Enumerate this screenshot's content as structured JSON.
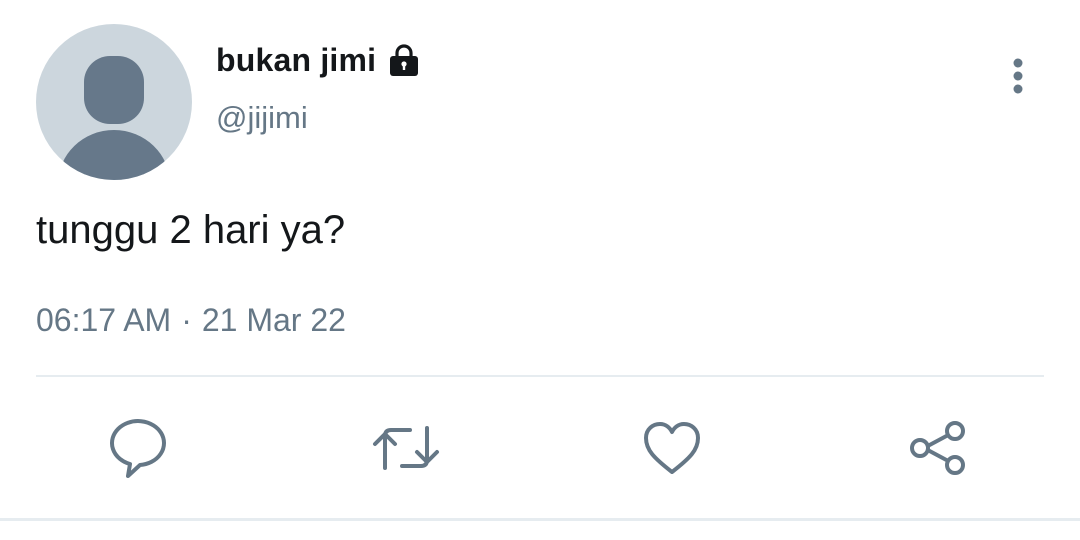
{
  "tweet": {
    "author": {
      "display_name": "bukan jimi",
      "handle": "@jijimi",
      "protected_icon": "lock-icon",
      "avatar_icon": "default-avatar"
    },
    "text": "tunggu 2 hari ya?",
    "time": "06:17 AM",
    "separator": "·",
    "date": "21 Mar 22"
  },
  "actions": [
    {
      "name": "reply",
      "icon": "comment-icon"
    },
    {
      "name": "retweet",
      "icon": "retweet-icon"
    },
    {
      "name": "like",
      "icon": "heart-icon"
    },
    {
      "name": "share",
      "icon": "share-icon"
    }
  ],
  "colors": {
    "text_primary": "#14171a",
    "text_secondary": "#657786",
    "avatar_bg": "#ccd6dd",
    "avatar_fg": "#66788a",
    "divider": "#e6ecf0"
  }
}
